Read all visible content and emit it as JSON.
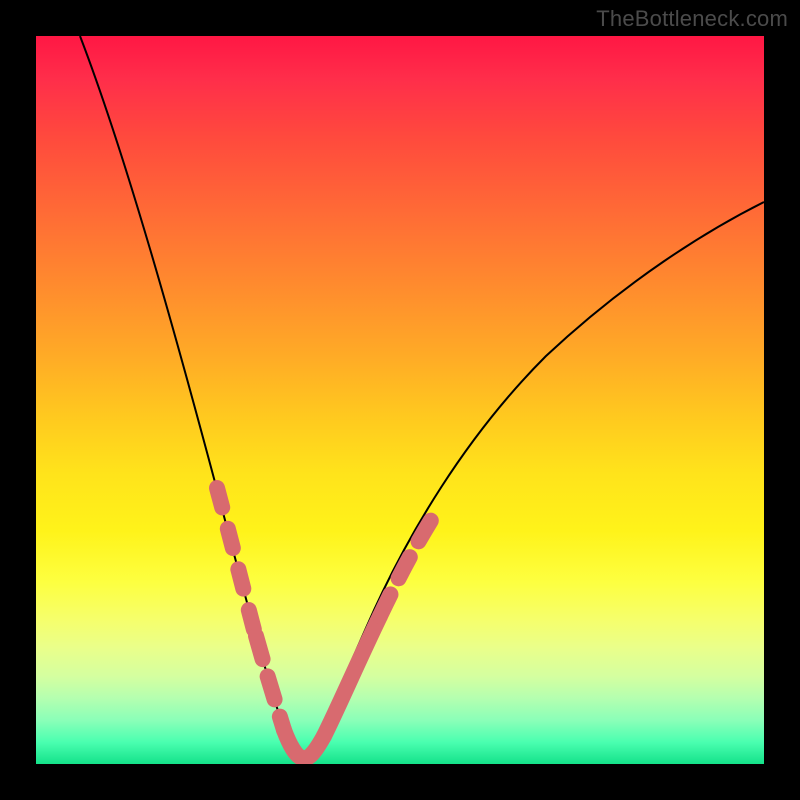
{
  "watermark": "TheBottleneck.com",
  "colors": {
    "frame": "#000000",
    "curve": "#000000",
    "overlay": "#d86a6f",
    "gradient_top": "#ff1744",
    "gradient_bottom": "#14e28a"
  },
  "chart_data": {
    "type": "line",
    "title": "",
    "xlabel": "",
    "ylabel": "",
    "xlim": [
      0,
      100
    ],
    "ylim": [
      0,
      100
    ],
    "grid": false,
    "legend": false,
    "series": [
      {
        "name": "bottleneck-curve",
        "x": [
          6,
          10,
          14,
          18,
          21,
          24,
          26,
          28,
          30,
          32,
          33,
          34,
          35,
          36,
          38,
          40,
          43,
          46,
          50,
          55,
          60,
          66,
          72,
          80,
          88,
          96,
          100
        ],
        "y": [
          100,
          88,
          74,
          60,
          48,
          36,
          27,
          19,
          12,
          6,
          3,
          1.5,
          1,
          1.5,
          3,
          6,
          11,
          17,
          24,
          32,
          39,
          46,
          53,
          61,
          68,
          74,
          77
        ]
      }
    ],
    "overlay_segments": [
      {
        "name": "left-dashed-upper",
        "style": "dashed",
        "x_range": [
          24,
          28
        ],
        "y_range": [
          36,
          19
        ]
      },
      {
        "name": "left-dashed-lower",
        "style": "dashed",
        "x_range": [
          28,
          32
        ],
        "y_range": [
          19,
          6
        ]
      },
      {
        "name": "valley-solid",
        "style": "solid",
        "x_range": [
          32,
          38.5
        ],
        "y_range": [
          6,
          4
        ]
      },
      {
        "name": "right-solid",
        "style": "solid",
        "x_range": [
          38.5,
          48
        ],
        "y_range": [
          4,
          21
        ]
      },
      {
        "name": "right-dashed",
        "style": "dashed",
        "x_range": [
          48,
          55
        ],
        "y_range": [
          21,
          32
        ]
      }
    ],
    "annotations": []
  }
}
